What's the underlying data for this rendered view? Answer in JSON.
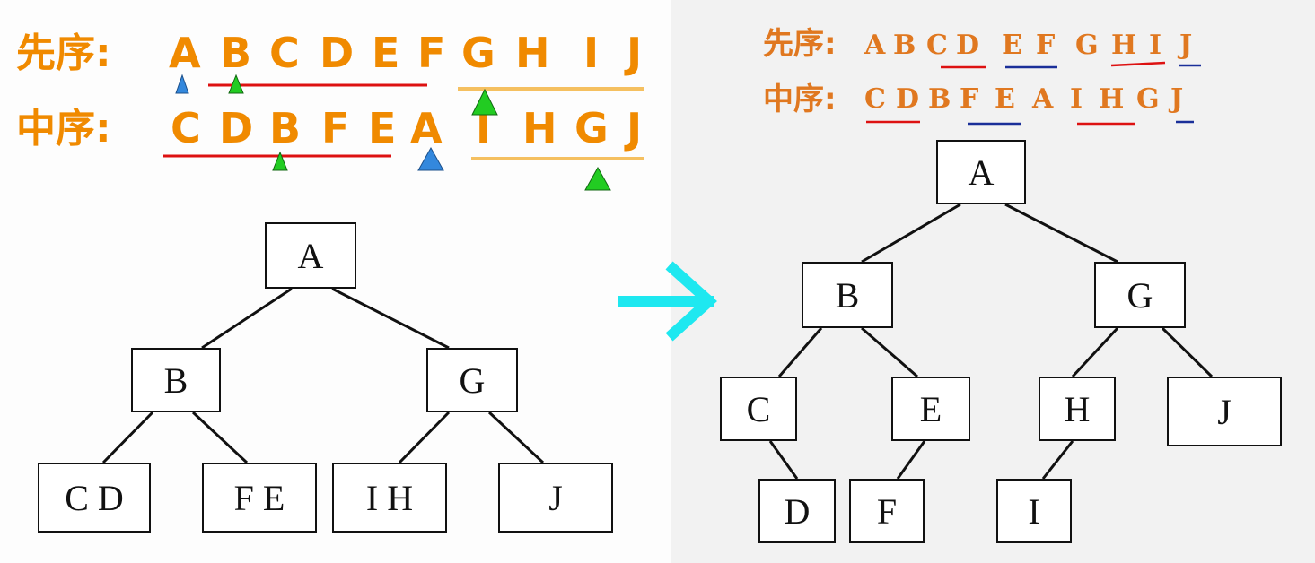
{
  "left": {
    "preorder_label": "先序:",
    "inorder_label": "中序:",
    "preorder_letters": [
      "A",
      "B",
      "C",
      "D",
      "E",
      "F",
      "G",
      "H",
      "I",
      "J"
    ],
    "inorder_letters": [
      "C",
      "D",
      "B",
      "F",
      "E",
      "A",
      "I",
      "H",
      "G",
      "J"
    ],
    "tree": {
      "root": "A",
      "b": "B",
      "g": "G",
      "cd": "C D",
      "fe": "F E",
      "ih": "I H",
      "j": "J"
    }
  },
  "right": {
    "preorder_label": "先序:",
    "inorder_label": "中序:",
    "preorder_letters": [
      "A",
      "B",
      "C",
      "D",
      "E",
      "F",
      "G",
      "H",
      "I",
      "J"
    ],
    "inorder_letters": [
      "C",
      "D",
      "B",
      "F",
      "E",
      "A",
      "I",
      "H",
      "G",
      "J"
    ],
    "tree": {
      "a": "A",
      "b": "B",
      "g": "G",
      "c": "C",
      "e": "E",
      "h": "H",
      "j": "J",
      "d": "D",
      "f": "F",
      "i": "I"
    }
  },
  "colors": {
    "orange": "#f08a00",
    "red_line": "#dd1111",
    "orange_line": "#f5c060",
    "blue_line": "#1a2f99",
    "arrow": "#1ee8f0",
    "green_marker": "#22cc22",
    "blue_marker": "#3388dd"
  }
}
